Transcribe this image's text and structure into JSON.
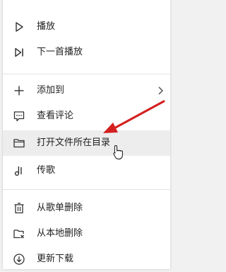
{
  "menu": {
    "items": [
      {
        "label": "播放",
        "icon": "play-icon"
      },
      {
        "label": "下一首播放",
        "icon": "play-next-icon"
      },
      {
        "label": "添加到",
        "icon": "plus-icon",
        "has_submenu": true
      },
      {
        "label": "查看评论",
        "icon": "comment-icon"
      },
      {
        "label": "打开文件所在目录",
        "icon": "folder-icon"
      },
      {
        "label": "传歌",
        "icon": "music-note-icon"
      },
      {
        "label": "从歌单删除",
        "icon": "trash-icon"
      },
      {
        "label": "从本地删除",
        "icon": "folder-delete-icon"
      },
      {
        "label": "更新下载",
        "icon": "download-icon"
      }
    ],
    "hovered_item": "打开文件所在目录"
  },
  "colors": {
    "menu_background": "#ffffff",
    "hover_background": "#ededed",
    "annotation_arrow": "#d42020"
  }
}
